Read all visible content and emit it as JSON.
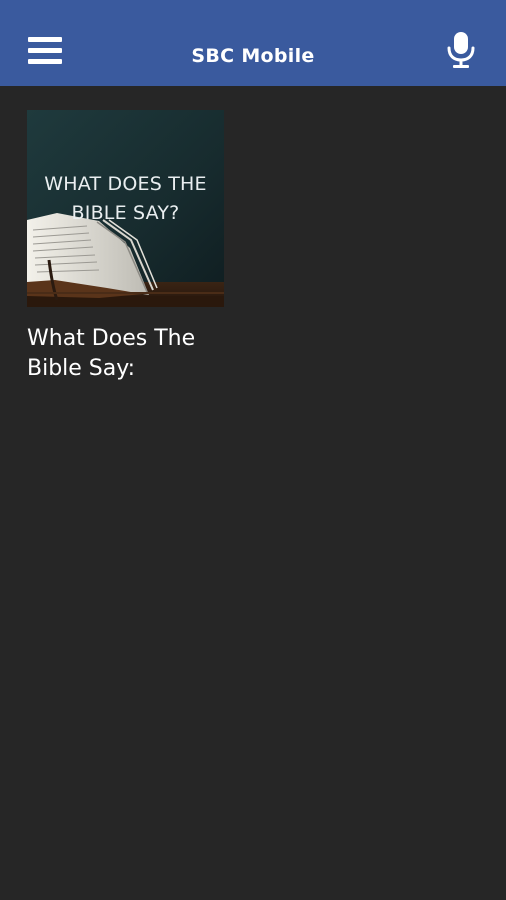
{
  "header": {
    "title": "SBC Mobile",
    "menu_icon": "hamburger-menu-icon",
    "mic_icon": "microphone-icon",
    "background_color": "#3a5a9e"
  },
  "content": {
    "background_color": "#262626",
    "items": [
      {
        "thumbnail_text": "WHAT DOES THE BIBLE SAY?",
        "title": "What Does The Bible Say:"
      }
    ]
  }
}
